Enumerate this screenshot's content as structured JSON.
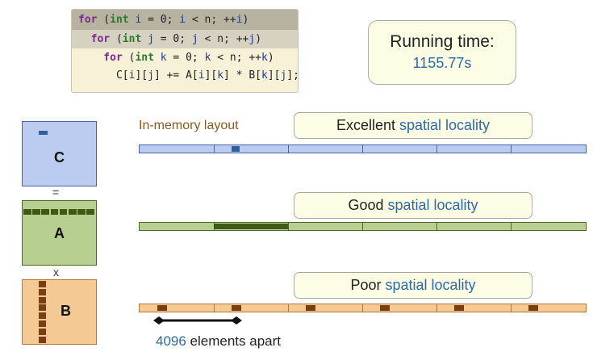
{
  "code": {
    "lines": [
      [
        {
          "t": "for",
          "c": "kw"
        },
        {
          "t": " (",
          "c": ""
        },
        {
          "t": "int",
          "c": "ty"
        },
        {
          "t": " ",
          "c": ""
        },
        {
          "t": "i",
          "c": "vi"
        },
        {
          "t": " = 0; ",
          "c": ""
        },
        {
          "t": "i",
          "c": "vi"
        },
        {
          "t": " < n; ++",
          "c": ""
        },
        {
          "t": "i",
          "c": "vi"
        },
        {
          "t": ")",
          "c": ""
        }
      ],
      [
        {
          "t": "  for",
          "c": "kw"
        },
        {
          "t": " (",
          "c": ""
        },
        {
          "t": "int",
          "c": "ty"
        },
        {
          "t": " ",
          "c": ""
        },
        {
          "t": "j",
          "c": "vj"
        },
        {
          "t": " = 0; ",
          "c": ""
        },
        {
          "t": "j",
          "c": "vj"
        },
        {
          "t": " < n; ++",
          "c": ""
        },
        {
          "t": "j",
          "c": "vj"
        },
        {
          "t": ")",
          "c": ""
        }
      ],
      [
        {
          "t": "    for",
          "c": "kw"
        },
        {
          "t": " (",
          "c": ""
        },
        {
          "t": "int",
          "c": "ty"
        },
        {
          "t": " ",
          "c": ""
        },
        {
          "t": "k",
          "c": "vk"
        },
        {
          "t": " = 0; ",
          "c": ""
        },
        {
          "t": "k",
          "c": "vk"
        },
        {
          "t": " < n; ++",
          "c": ""
        },
        {
          "t": "k",
          "c": "vk"
        },
        {
          "t": ")",
          "c": ""
        }
      ],
      [
        {
          "t": "      C[",
          "c": ""
        },
        {
          "t": "i",
          "c": "vi"
        },
        {
          "t": "][",
          "c": ""
        },
        {
          "t": "j",
          "c": "vj"
        },
        {
          "t": "] += A[",
          "c": ""
        },
        {
          "t": "i",
          "c": "vi"
        },
        {
          "t": "][",
          "c": ""
        },
        {
          "t": "k",
          "c": "vk"
        },
        {
          "t": "] * B[",
          "c": ""
        },
        {
          "t": "k",
          "c": "vk"
        },
        {
          "t": "][",
          "c": ""
        },
        {
          "t": "j",
          "c": "vj"
        },
        {
          "t": "];",
          "c": ""
        }
      ]
    ]
  },
  "running_time": {
    "label": "Running time:",
    "value": "1155.77s"
  },
  "matrices": {
    "c": "C",
    "a": "A",
    "b": "B",
    "equals": "=",
    "times": "x"
  },
  "layout_label": "In-memory layout",
  "locality": {
    "c": {
      "prefix": "Excellent ",
      "highlight": "spatial locality"
    },
    "a": {
      "prefix": "Good ",
      "highlight": "spatial locality"
    },
    "b": {
      "prefix": "Poor ",
      "highlight": "spatial locality"
    }
  },
  "apart": {
    "number": "4096",
    "text": " elements apart"
  },
  "colors": {
    "c_fill": "#bccbf0",
    "c_block": "#2f5f9f",
    "a_fill": "#b7d08f",
    "a_block": "#3f5a12",
    "b_fill": "#f5c993",
    "b_block": "#7a3e14",
    "highlight": "#2f6aa6"
  }
}
